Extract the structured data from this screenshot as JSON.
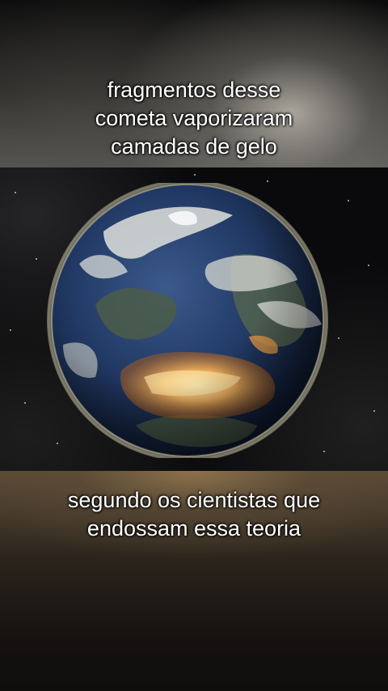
{
  "captions": {
    "top": [
      "fragmentos desse",
      "cometa vaporizaram",
      "camadas de gelo"
    ],
    "bottom": [
      "segundo os cientistas que",
      "endossam essa teoria"
    ]
  },
  "scene": {
    "subject_icon": "planet-icon",
    "colors": {
      "ocean": "#2a3d6b",
      "clouds": "#d9dbd6",
      "fire": "#e8a34a",
      "space": "#0a0a0c"
    }
  }
}
